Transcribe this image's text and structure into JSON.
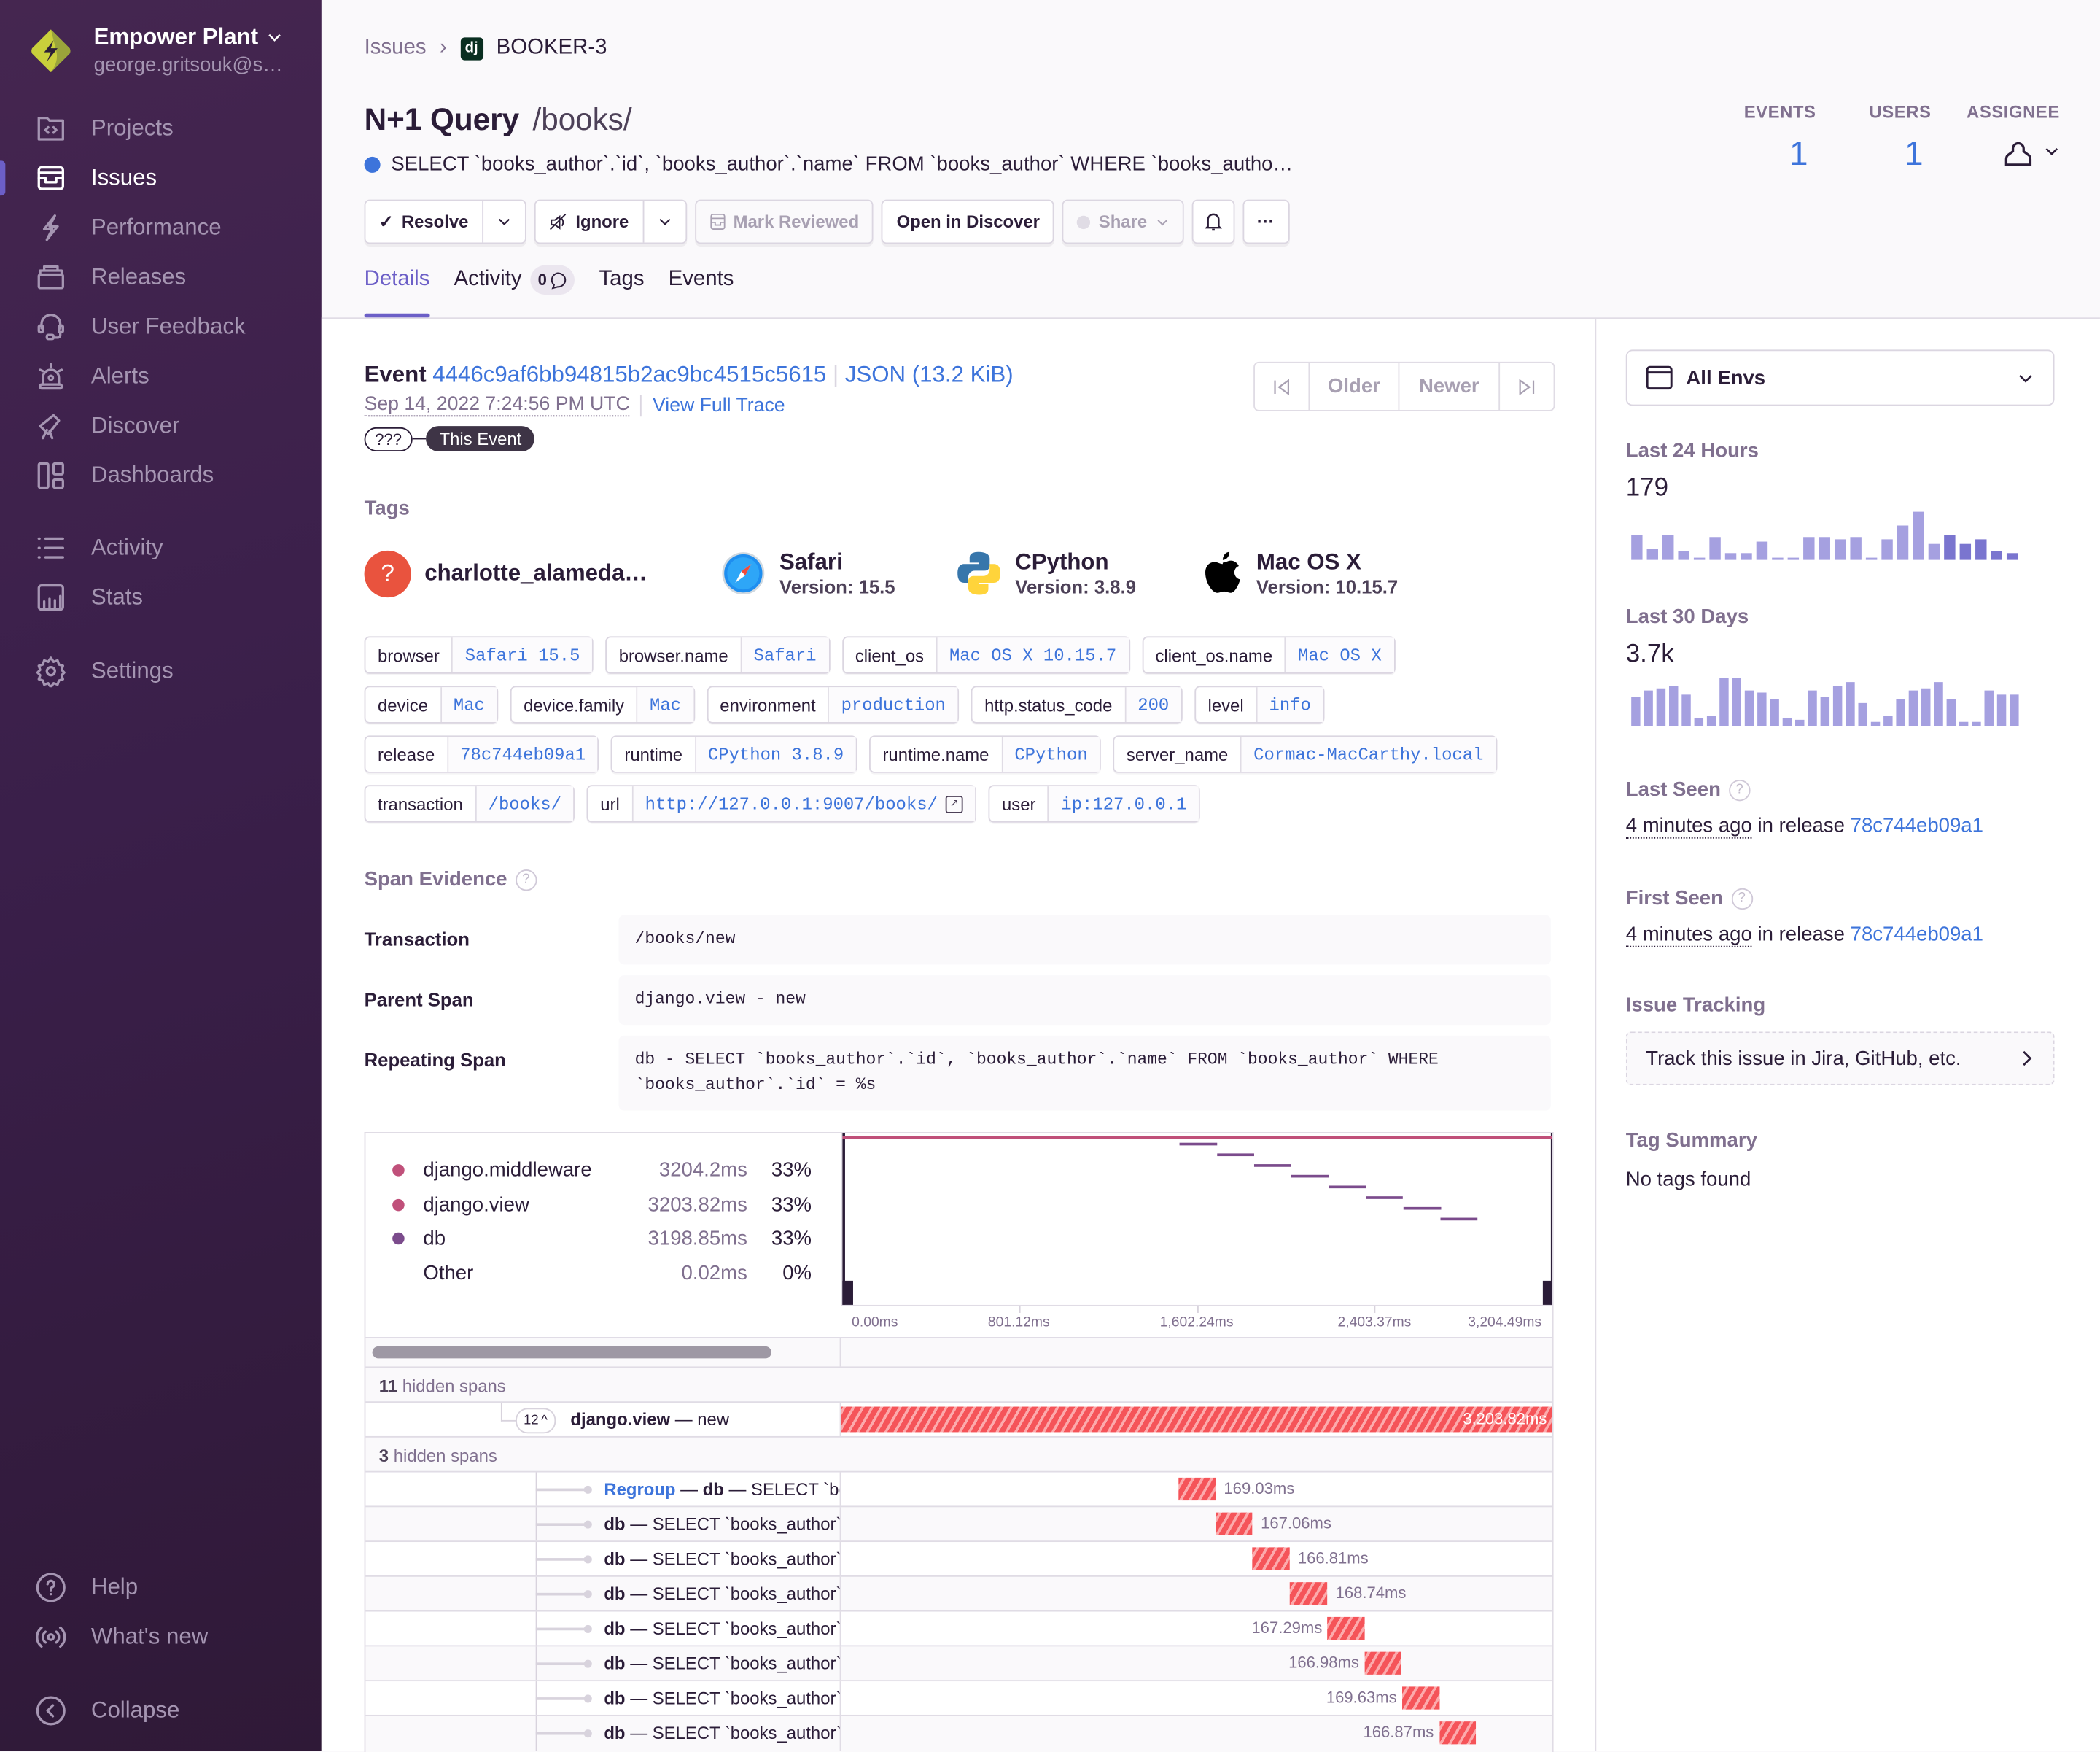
{
  "sidebar": {
    "org_name": "Empower Plant",
    "org_user": "george.gritsouk@s…",
    "items": [
      {
        "label": "Projects",
        "icon": "projects-icon"
      },
      {
        "label": "Issues",
        "icon": "issues-icon",
        "active": true
      },
      {
        "label": "Performance",
        "icon": "performance-icon"
      },
      {
        "label": "Releases",
        "icon": "releases-icon"
      },
      {
        "label": "User Feedback",
        "icon": "user-feedback-icon"
      },
      {
        "label": "Alerts",
        "icon": "alerts-icon"
      },
      {
        "label": "Discover",
        "icon": "discover-icon"
      },
      {
        "label": "Dashboards",
        "icon": "dashboards-icon"
      },
      {
        "label": "Activity",
        "icon": "activity-icon"
      },
      {
        "label": "Stats",
        "icon": "stats-icon"
      },
      {
        "label": "Settings",
        "icon": "settings-icon"
      }
    ],
    "footer": [
      {
        "label": "Help",
        "icon": "help-icon"
      },
      {
        "label": "What's new",
        "icon": "broadcast-icon"
      },
      {
        "label": "Collapse",
        "icon": "collapse-icon"
      }
    ]
  },
  "header": {
    "breadcrumb": {
      "parent": "Issues",
      "project_icon": "dj",
      "current": "BOOKER-3"
    },
    "title": "N+1 Query",
    "subtitle": "/books/",
    "message": "SELECT `books_author`.`id`, `books_author`.`name` FROM `books_author` WHERE `books_autho…",
    "actions": {
      "resolve": "Resolve",
      "ignore": "Ignore",
      "mark_reviewed": "Mark Reviewed",
      "open_discover": "Open in Discover",
      "share": "Share",
      "more": "···"
    },
    "stats": {
      "events_label": "EVENTS",
      "events": "1",
      "users_label": "USERS",
      "users": "1",
      "assignee_label": "ASSIGNEE"
    },
    "tabs": [
      {
        "label": "Details",
        "active": true
      },
      {
        "label": "Activity",
        "badge": "0"
      },
      {
        "label": "Tags"
      },
      {
        "label": "Events"
      }
    ]
  },
  "event": {
    "label": "Event",
    "id": "4446c9af6bb94815b2ac9bc4515c5615",
    "json": "JSON (13.2 KiB)",
    "timestamp": "Sep 14, 2022 7:24:56 PM UTC",
    "view_trace": "View Full Trace",
    "chip_unknown": "???",
    "chip_this": "This Event",
    "pager": {
      "older": "Older",
      "newer": "Newer"
    }
  },
  "tags_section": {
    "title": "Tags",
    "contexts": [
      {
        "title": "charlotte_alameda…",
        "version": "",
        "icon": "unknown-user-icon"
      },
      {
        "title": "Safari",
        "version": "Version: 15.5",
        "icon": "safari-icon"
      },
      {
        "title": "CPython",
        "version": "Version: 3.8.9",
        "icon": "python-icon"
      },
      {
        "title": "Mac OS X",
        "version": "Version: 10.15.7",
        "icon": "apple-icon"
      }
    ],
    "rows": [
      [
        {
          "k": "browser",
          "v": "Safari 15.5"
        },
        {
          "k": "browser.name",
          "v": "Safari"
        },
        {
          "k": "client_os",
          "v": "Mac OS X 10.15.7"
        },
        {
          "k": "client_os.name",
          "v": "Mac OS X"
        }
      ],
      [
        {
          "k": "device",
          "v": "Mac"
        },
        {
          "k": "device.family",
          "v": "Mac"
        },
        {
          "k": "environment",
          "v": "production"
        },
        {
          "k": "http.status_code",
          "v": "200"
        },
        {
          "k": "level",
          "v": "info"
        }
      ],
      [
        {
          "k": "release",
          "v": "78c744eb09a1"
        },
        {
          "k": "runtime",
          "v": "CPython 3.8.9"
        },
        {
          "k": "runtime.name",
          "v": "CPython"
        },
        {
          "k": "server_name",
          "v": "Cormac-MacCarthy.local"
        }
      ],
      [
        {
          "k": "transaction",
          "v": "/books/"
        },
        {
          "k": "url",
          "v": "http://127.0.0.1:9007/books/",
          "external": true
        },
        {
          "k": "user",
          "v": "ip:127.0.0.1"
        }
      ]
    ]
  },
  "span_evidence": {
    "title": "Span Evidence",
    "rows": [
      {
        "k": "Transaction",
        "v": "/books/new"
      },
      {
        "k": "Parent Span",
        "v": "django.view - new"
      },
      {
        "k": "Repeating Span",
        "v": "db - SELECT `books_author`.`id`, `books_author`.`name` FROM `books_author` WHERE `books_author`.`id` = %s"
      }
    ]
  },
  "waterfall": {
    "ops": [
      {
        "name": "django.middleware",
        "duration": "3204.2ms",
        "pct": "33%",
        "color": "#c0507a"
      },
      {
        "name": "django.view",
        "duration": "3203.82ms",
        "pct": "33%",
        "color": "#c0507a"
      },
      {
        "name": "db",
        "duration": "3198.85ms",
        "pct": "33%",
        "color": "#7b4b8c"
      },
      {
        "name": "Other",
        "duration": "0.02ms",
        "pct": "0%",
        "color": ""
      }
    ],
    "axis_ticks": [
      "0.00ms",
      "801.12ms",
      "1,602.24ms",
      "2,403.37ms",
      "3,204.49ms"
    ],
    "hidden_1": {
      "count": "11",
      "label": "hidden spans"
    },
    "parent_span": {
      "count": "12",
      "op": "django.view",
      "desc": "— new",
      "duration": "3,203.82ms"
    },
    "hidden_2": {
      "count": "3",
      "label": "hidden spans"
    },
    "regroup": "Regroup",
    "child_spans": [
      {
        "op": "db",
        "desc": "— SELECT `books_author`",
        "duration": "169.03ms",
        "start_frac": 0.474,
        "width_frac": 0.053,
        "label_side": "right"
      },
      {
        "op": "db",
        "desc": "— SELECT `books_author`",
        "duration": "167.06ms",
        "start_frac": 0.527,
        "width_frac": 0.052,
        "label_side": "right"
      },
      {
        "op": "db",
        "desc": "— SELECT `books_author`",
        "duration": "166.81ms",
        "start_frac": 0.579,
        "width_frac": 0.052,
        "label_side": "right"
      },
      {
        "op": "db",
        "desc": "— SELECT `books_author`",
        "duration": "168.74ms",
        "start_frac": 0.631,
        "width_frac": 0.053,
        "label_side": "right"
      },
      {
        "op": "db",
        "desc": "— SELECT `books_author`",
        "duration": "167.29ms",
        "start_frac": 0.684,
        "width_frac": 0.052,
        "label_side": "left"
      },
      {
        "op": "db",
        "desc": "— SELECT `books_author`",
        "duration": "166.98ms",
        "start_frac": 0.736,
        "width_frac": 0.052,
        "label_side": "left"
      },
      {
        "op": "db",
        "desc": "— SELECT `books_author`",
        "duration": "169.63ms",
        "start_frac": 0.789,
        "width_frac": 0.053,
        "label_side": "left"
      },
      {
        "op": "db",
        "desc": "— SELECT `books_author`",
        "duration": "166.87ms",
        "start_frac": 0.841,
        "width_frac": 0.052,
        "label_side": "left"
      }
    ]
  },
  "side": {
    "env": "All Envs",
    "last24_label": "Last 24 Hours",
    "last24_value": "179",
    "last24_bars": [
      11,
      5,
      11,
      4,
      1,
      10,
      3,
      3,
      8,
      1,
      1,
      10,
      10,
      9,
      10,
      1,
      9,
      15,
      21,
      7,
      11,
      7,
      9,
      4,
      3
    ],
    "last30_label": "Last 30 Days",
    "last30_value": "3.7k",
    "last30_bars": [
      7,
      8.5,
      9,
      9.5,
      7.5,
      2,
      2.5,
      11.5,
      11.5,
      8.5,
      8,
      6.5,
      2,
      1.5,
      8.5,
      7,
      9.5,
      10.5,
      5.5,
      1,
      2.5,
      6.5,
      8.5,
      9,
      10.5,
      6.5,
      1,
      1,
      8.5,
      7.5,
      7.5
    ],
    "last_seen_label": "Last Seen",
    "last_seen_time": "4 minutes ago",
    "first_seen_label": "First Seen",
    "first_seen_time": "4 minutes ago",
    "in_release": "in release",
    "release": "78c744eb09a1",
    "issue_tracking_label": "Issue Tracking",
    "issue_tracking_cta": "Track this issue in Jira, GitHub, etc.",
    "tag_summary_label": "Tag Summary",
    "tag_summary_empty": "No tags found"
  }
}
